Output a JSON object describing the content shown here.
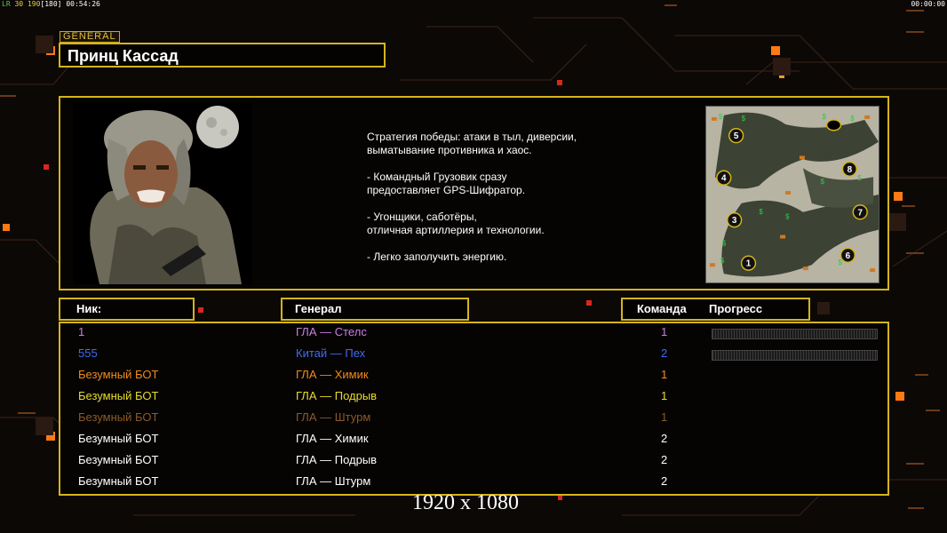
{
  "hud": {
    "left_parts": [
      "LR",
      "30",
      "190",
      "[180]",
      "00:54:26"
    ],
    "right_clock": "00:00:00"
  },
  "header": {
    "tag": "GENERAL",
    "general_name": "Принц Кассад"
  },
  "description": "Стратегия победы: атаки в тыл, диверсии,\n выматывание противника и хаос.\n\n- Командный Грузовик сразу\nпредоставляет GPS-Шифратор.\n\n- Угонщики, саботёры,\nотличная артиллерия и технологии.\n\n- Легко заполучить энергию.",
  "minimap": {
    "start_positions": [
      "1",
      "3",
      "4",
      "5",
      "6",
      "7",
      "8"
    ]
  },
  "columns": {
    "nick": "Ник:",
    "general": "Генерал",
    "team": "Команда",
    "progress": "Прогресс"
  },
  "players": [
    {
      "nick": "1",
      "general": "ГЛА — Стелс",
      "team": "1",
      "color": "#c97ee6",
      "show_progress": true
    },
    {
      "nick": "555",
      "general": "Китай — Пех",
      "team": "2",
      "color": "#3f6bf0",
      "show_progress": true
    },
    {
      "nick": "Безумный БОТ",
      "general": "ГЛА — Химик",
      "team": "1",
      "color": "#f08a1c",
      "show_progress": false
    },
    {
      "nick": "Безумный БОТ",
      "general": "ГЛА — Подрыв",
      "team": "1",
      "color": "#e6dc2a",
      "show_progress": false
    },
    {
      "nick": "Безумный БОТ",
      "general": "ГЛА — Штурм",
      "team": "1",
      "color": "#8a5a2a",
      "show_progress": false
    },
    {
      "nick": "Безумный БОТ",
      "general": "ГЛА — Химик",
      "team": "2",
      "color": "#ffffff",
      "show_progress": false
    },
    {
      "nick": "Безумный БОТ",
      "general": "ГЛА — Подрыв",
      "team": "2",
      "color": "#ffffff",
      "show_progress": false
    },
    {
      "nick": "Безумный БОТ",
      "general": "ГЛА — Штурм",
      "team": "2",
      "color": "#ffffff",
      "show_progress": false
    }
  ],
  "resolution_label": "1920 x 1080",
  "colors": {
    "frame_gold": "#d4b41c",
    "accent_orange": "#ff8a1a",
    "accent_red": "#d8281c"
  }
}
